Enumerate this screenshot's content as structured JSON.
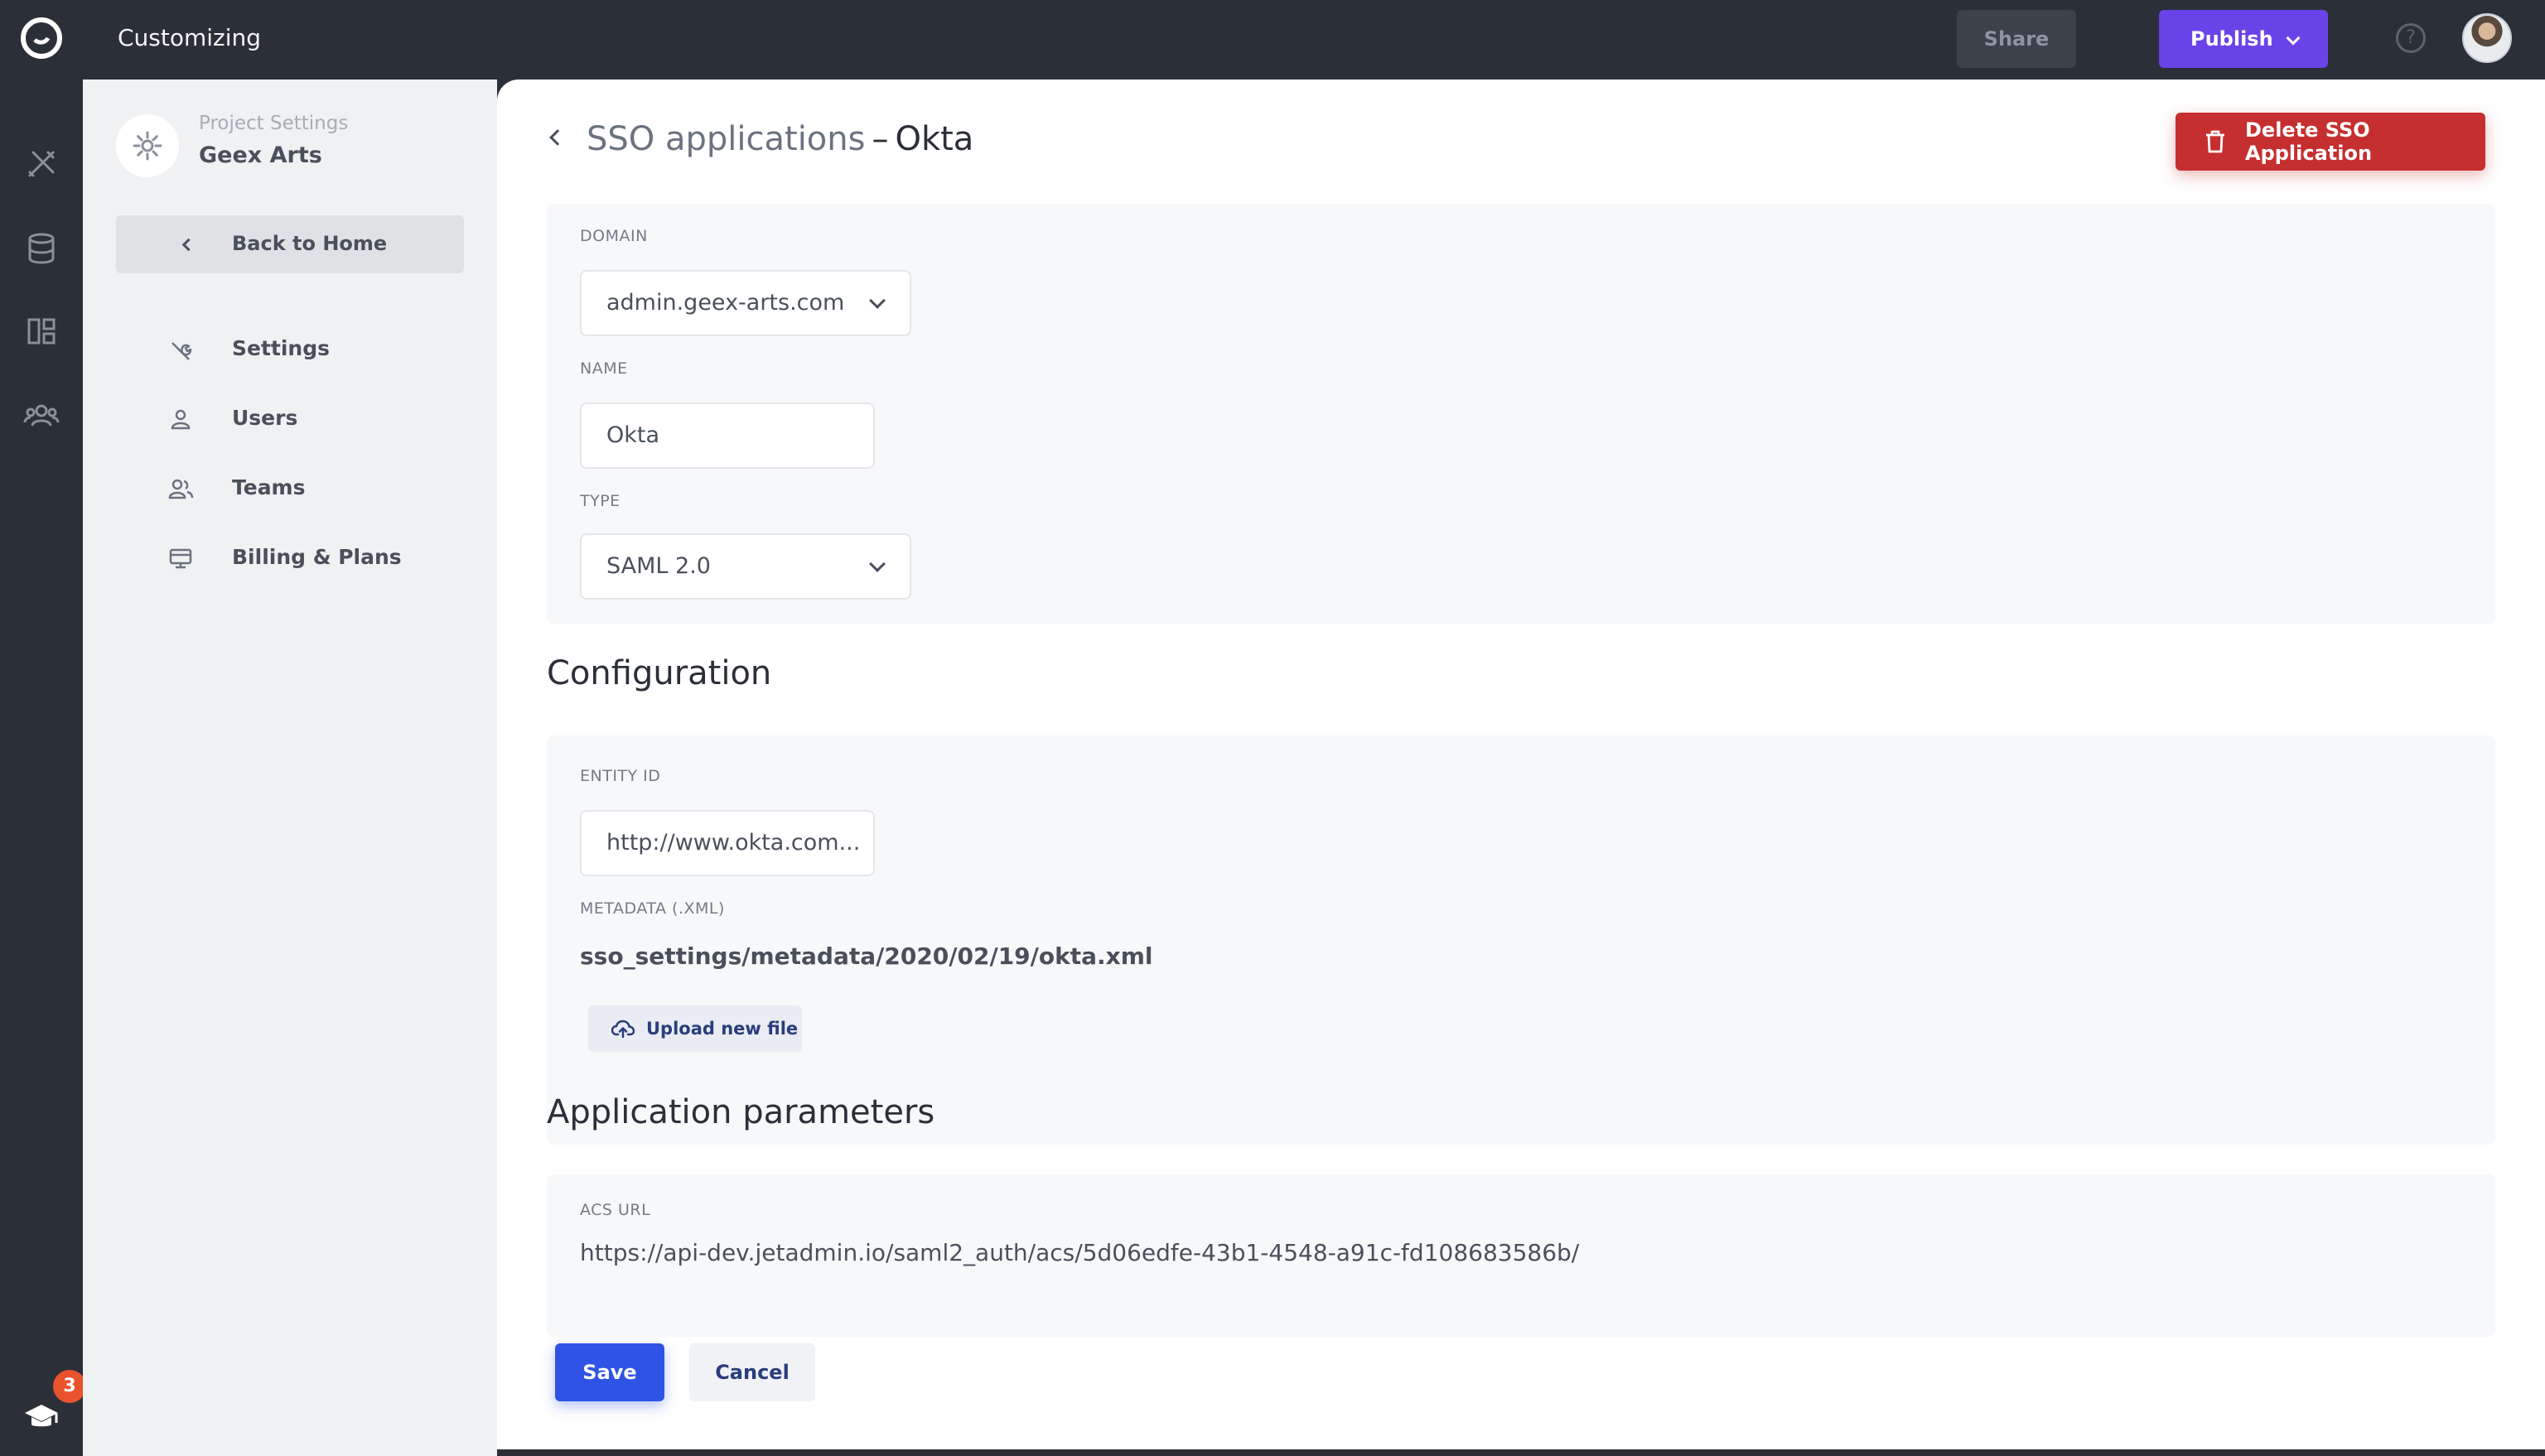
{
  "topbar": {
    "title": "Customizing",
    "share_label": "Share",
    "publish_label": "Publish",
    "help_glyph": "?"
  },
  "rail": {
    "icons": [
      "logo-icon",
      "builder-tools-icon",
      "database-icon",
      "layout-icon",
      "users-group-icon",
      "graduation-cap-icon"
    ],
    "badge_count": "3",
    "badge_color": "#e8532d"
  },
  "sidebar": {
    "project_label": "Project Settings",
    "project_name": "Geex Arts",
    "back_label": "Back to Home",
    "items": [
      {
        "label": "Settings",
        "icon": "wrench-icon"
      },
      {
        "label": "Users",
        "icon": "user-icon"
      },
      {
        "label": "Teams",
        "icon": "team-icon"
      },
      {
        "label": "Billing & Plans",
        "icon": "billing-icon"
      }
    ]
  },
  "header": {
    "breadcrumb": "SSO applications",
    "separator": "–",
    "current": "Okta",
    "delete_label": "Delete SSO Application",
    "delete_color": "#c62f2f"
  },
  "form": {
    "domain_label": "DOMAIN",
    "domain_value": "admin.geex-arts.com",
    "name_label": "NAME",
    "name_value": "Okta",
    "type_label": "TYPE",
    "type_value": "SAML 2.0"
  },
  "configuration": {
    "title": "Configuration",
    "entity_id_label": "ENTITY ID",
    "entity_id_value": "http://www.okta.com...",
    "metadata_label": "METADATA (.XML)",
    "metadata_path": "sso_settings/metadata/2020/02/19/okta.xml",
    "upload_label": "Upload new file"
  },
  "app_params": {
    "title": "Application parameters",
    "acs_label": "ACS URL",
    "acs_value": "https://api-dev.jetadmin.io/saml2_auth/acs/5d06edfe-43b1-4548-a91c-fd108683586b/"
  },
  "actions": {
    "save_label": "Save",
    "cancel_label": "Cancel",
    "accent": "#2f54e5"
  }
}
